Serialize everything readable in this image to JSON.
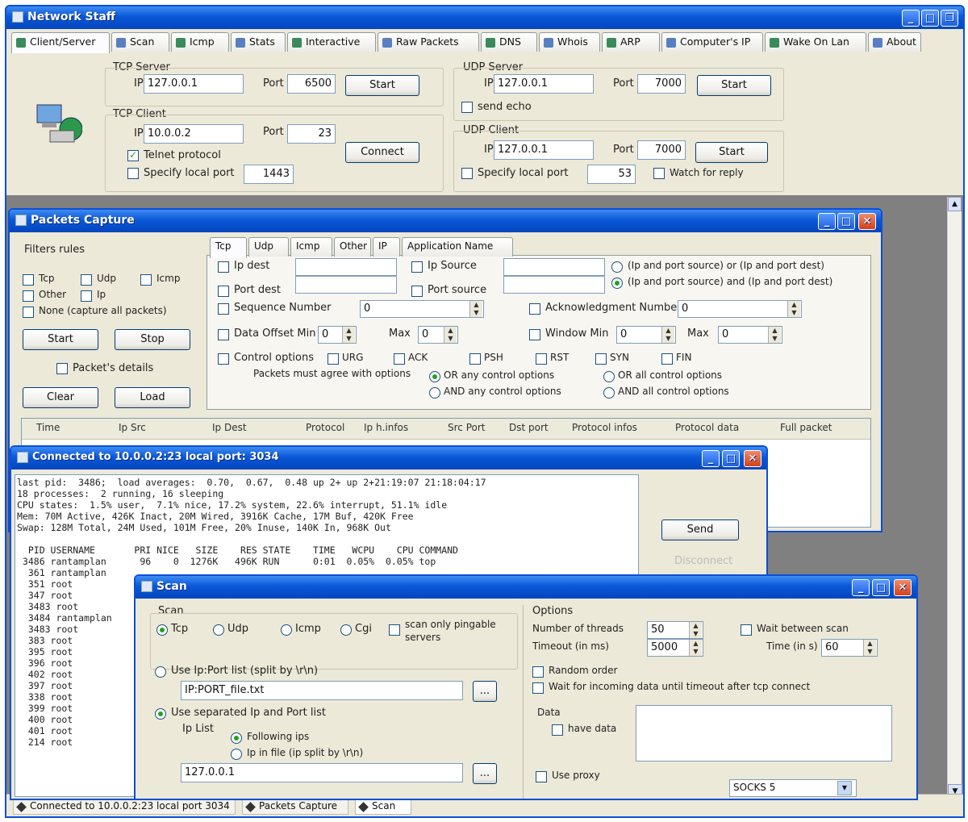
{
  "main": {
    "title": "Network Staff",
    "tabs": [
      "Client/Server",
      "Scan",
      "Icmp",
      "Stats",
      "Interactive",
      "Raw Packets",
      "DNS",
      "Whois",
      "ARP",
      "Computer's IP",
      "Wake On Lan",
      "About"
    ],
    "tcp_server": {
      "label": "TCP Server",
      "ip_label": "IP",
      "ip": "127.0.0.1",
      "port_label": "Port",
      "port": "6500",
      "button": "Start"
    },
    "tcp_client": {
      "label": "TCP Client",
      "ip_label": "IP",
      "ip": "10.0.0.2",
      "port_label": "Port",
      "port": "23",
      "telnet": "Telnet protocol",
      "specify": "Specify local port",
      "local_port": "1443",
      "button": "Connect"
    },
    "udp_server": {
      "label": "UDP Server",
      "ip_label": "IP",
      "ip": "127.0.0.1",
      "port_label": "Port",
      "port": "7000",
      "button": "Start",
      "echo": "send echo"
    },
    "udp_client": {
      "label": "UDP Client",
      "ip_label": "IP",
      "ip": "127.0.0.1",
      "port_label": "Port",
      "port": "7000",
      "button": "Start",
      "specify": "Specify local port",
      "local_port": "53",
      "watch": "Watch for reply"
    }
  },
  "capture": {
    "title": "Packets Capture",
    "filters_label": "Filters rules",
    "filters": [
      "Tcp",
      "Udp",
      "Icmp",
      "Other",
      "Ip",
      "None (capture all packets)"
    ],
    "start": "Start",
    "stop": "Stop",
    "details": "Packet's details",
    "clear": "Clear",
    "load": "Load",
    "tabs": [
      "Tcp",
      "Udp",
      "Icmp",
      "Other",
      "IP",
      "Application Name"
    ],
    "ip_dest": "Ip dest",
    "ip_source": "Ip Source",
    "port_dest": "Port dest",
    "port_source": "Port source",
    "opt_or": "(Ip and port source) or (Ip and port dest)",
    "opt_and": "(Ip and port source) and (Ip and port dest)",
    "seq": "Sequence Number",
    "seq_val": "0",
    "ack": "Acknowledgment Number",
    "ack_val": "0",
    "dom": "Data Offset Min",
    "dom_val": "0",
    "max": "Max",
    "max_val": "0",
    "win": "Window Min",
    "win_val": "0",
    "max2": "Max",
    "max2_val": "0",
    "ctrl": "Control options",
    "flags": [
      "URG",
      "ACK",
      "PSH",
      "RST",
      "SYN",
      "FIN"
    ],
    "agree": "Packets must agree with options",
    "or_any": "OR any control options",
    "and_any": "AND any control options",
    "or_all": "OR all control options",
    "and_all": "AND all control options",
    "columns": [
      "Time",
      "Ip Src",
      "Ip Dest",
      "Protocol",
      "Ip h.infos",
      "Src Port",
      "Dst port",
      "Protocol infos",
      "Protocol data",
      "Full packet"
    ]
  },
  "telnet": {
    "title": "Connected to 10.0.0.2:23 local port: 3034",
    "send": "Send",
    "disconnect": "Disconnect",
    "lines": [
      "last pid:  3486;  load averages:  0.70,  0.67,  0.48 up 2+ up 2+21:19:07 21:18:04:17",
      "18 processes:  2 running, 16 sleeping",
      "CPU states:  1.5% user,  7.1% nice, 17.2% system, 22.6% interrupt, 51.1% idle",
      "Mem: 70M Active, 426K Inact, 20M Wired, 3916K Cache, 17M Buf, 420K Free",
      "Swap: 128M Total, 24M Used, 101M Free, 20% Inuse, 140K In, 968K Out",
      "",
      "  PID USERNAME       PRI NICE   SIZE    RES STATE    TIME   WCPU    CPU COMMAND",
      " 3486 rantamplan      96    0  1276K   496K RUN      0:01  0.05%  0.05% top",
      "  361 rantamplan",
      "  351 root",
      "  347 root",
      "  3483 root",
      "  3484 rantamplan",
      "  3483 root",
      "  383 root",
      "  395 root",
      "  396 root",
      "  402 root",
      "  397 root",
      "  338 root",
      "  399 root",
      "  400 root",
      "  401 root",
      "  214 root"
    ]
  },
  "scan": {
    "title": "Scan",
    "scan_label": "Scan",
    "protos": [
      "Tcp",
      "Udp",
      "Icmp",
      "Cgi"
    ],
    "pingable": "scan only pingable servers",
    "use_list": "Use Ip:Port list (split by \\r\\n)",
    "list_file": "IP:PORT_file.txt",
    "browse": "...",
    "use_sep": "Use separated Ip and Port list",
    "ip_list": "Ip List",
    "following": "Following ips",
    "in_file": "Ip in file (ip split by \\r\\n)",
    "ip_val": "127.0.0.1",
    "options": "Options",
    "threads": "Number of threads",
    "threads_val": "50",
    "timeout": "Timeout (in ms)",
    "timeout_val": "5000",
    "wait": "Wait between scan",
    "time": "Time (in s)",
    "time_val": "60",
    "random": "Random order",
    "wait_incoming": "Wait for incoming data until timeout after tcp connect",
    "data": "Data",
    "have_data": "have data",
    "use_proxy": "Use proxy",
    "proxy_type": "SOCKS 5"
  },
  "taskbar": [
    "Connected to 10.0.0.2:23 local port 3034",
    "Packets Capture",
    "Scan"
  ]
}
